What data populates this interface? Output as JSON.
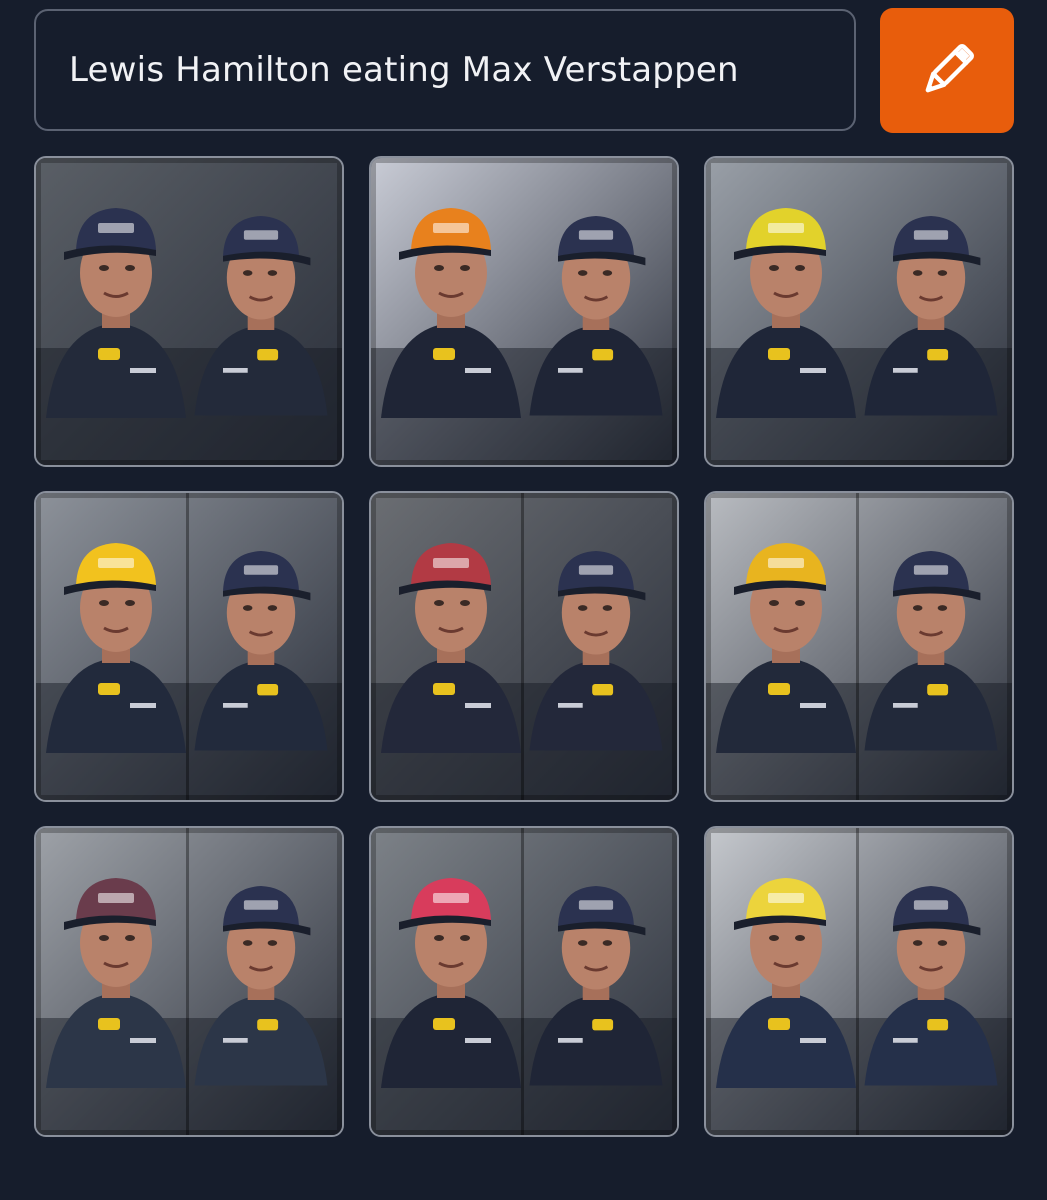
{
  "prompt": {
    "text": "Lewis Hamilton eating Max Verstappen"
  },
  "run_button": {
    "icon": "pencil-icon",
    "color": "#e85d0c"
  },
  "results": {
    "count": 9,
    "images": [
      {
        "id": "result-1",
        "cap_color": "#2b3250",
        "bg_color": "#5a5f66",
        "suit_color": "#232a3a"
      },
      {
        "id": "result-2",
        "cap_color": "#e8811d",
        "bg_color": "#c9ccd6",
        "suit_color": "#1f2536"
      },
      {
        "id": "result-3",
        "cap_color": "#e2d22b",
        "bg_color": "#9aa0a8",
        "suit_color": "#1f2638"
      },
      {
        "id": "result-4",
        "cap_color": "#f2c21e",
        "bg_color": "#8d929a",
        "suit_color": "#222a3c"
      },
      {
        "id": "result-5",
        "cap_color": "#b23a44",
        "bg_color": "#6b6e73",
        "suit_color": "#23283a"
      },
      {
        "id": "result-6",
        "cap_color": "#e8b41f",
        "bg_color": "#b9bcc1",
        "suit_color": "#22293a"
      },
      {
        "id": "result-7",
        "cap_color": "#6a3c4c",
        "bg_color": "#9ea2a8",
        "suit_color": "#2c3648"
      },
      {
        "id": "result-8",
        "cap_color": "#d83c5c",
        "bg_color": "#7d8288",
        "suit_color": "#1f2536"
      },
      {
        "id": "result-9",
        "cap_color": "#ecd43c",
        "bg_color": "#c6c9ce",
        "suit_color": "#25304a"
      }
    ]
  }
}
